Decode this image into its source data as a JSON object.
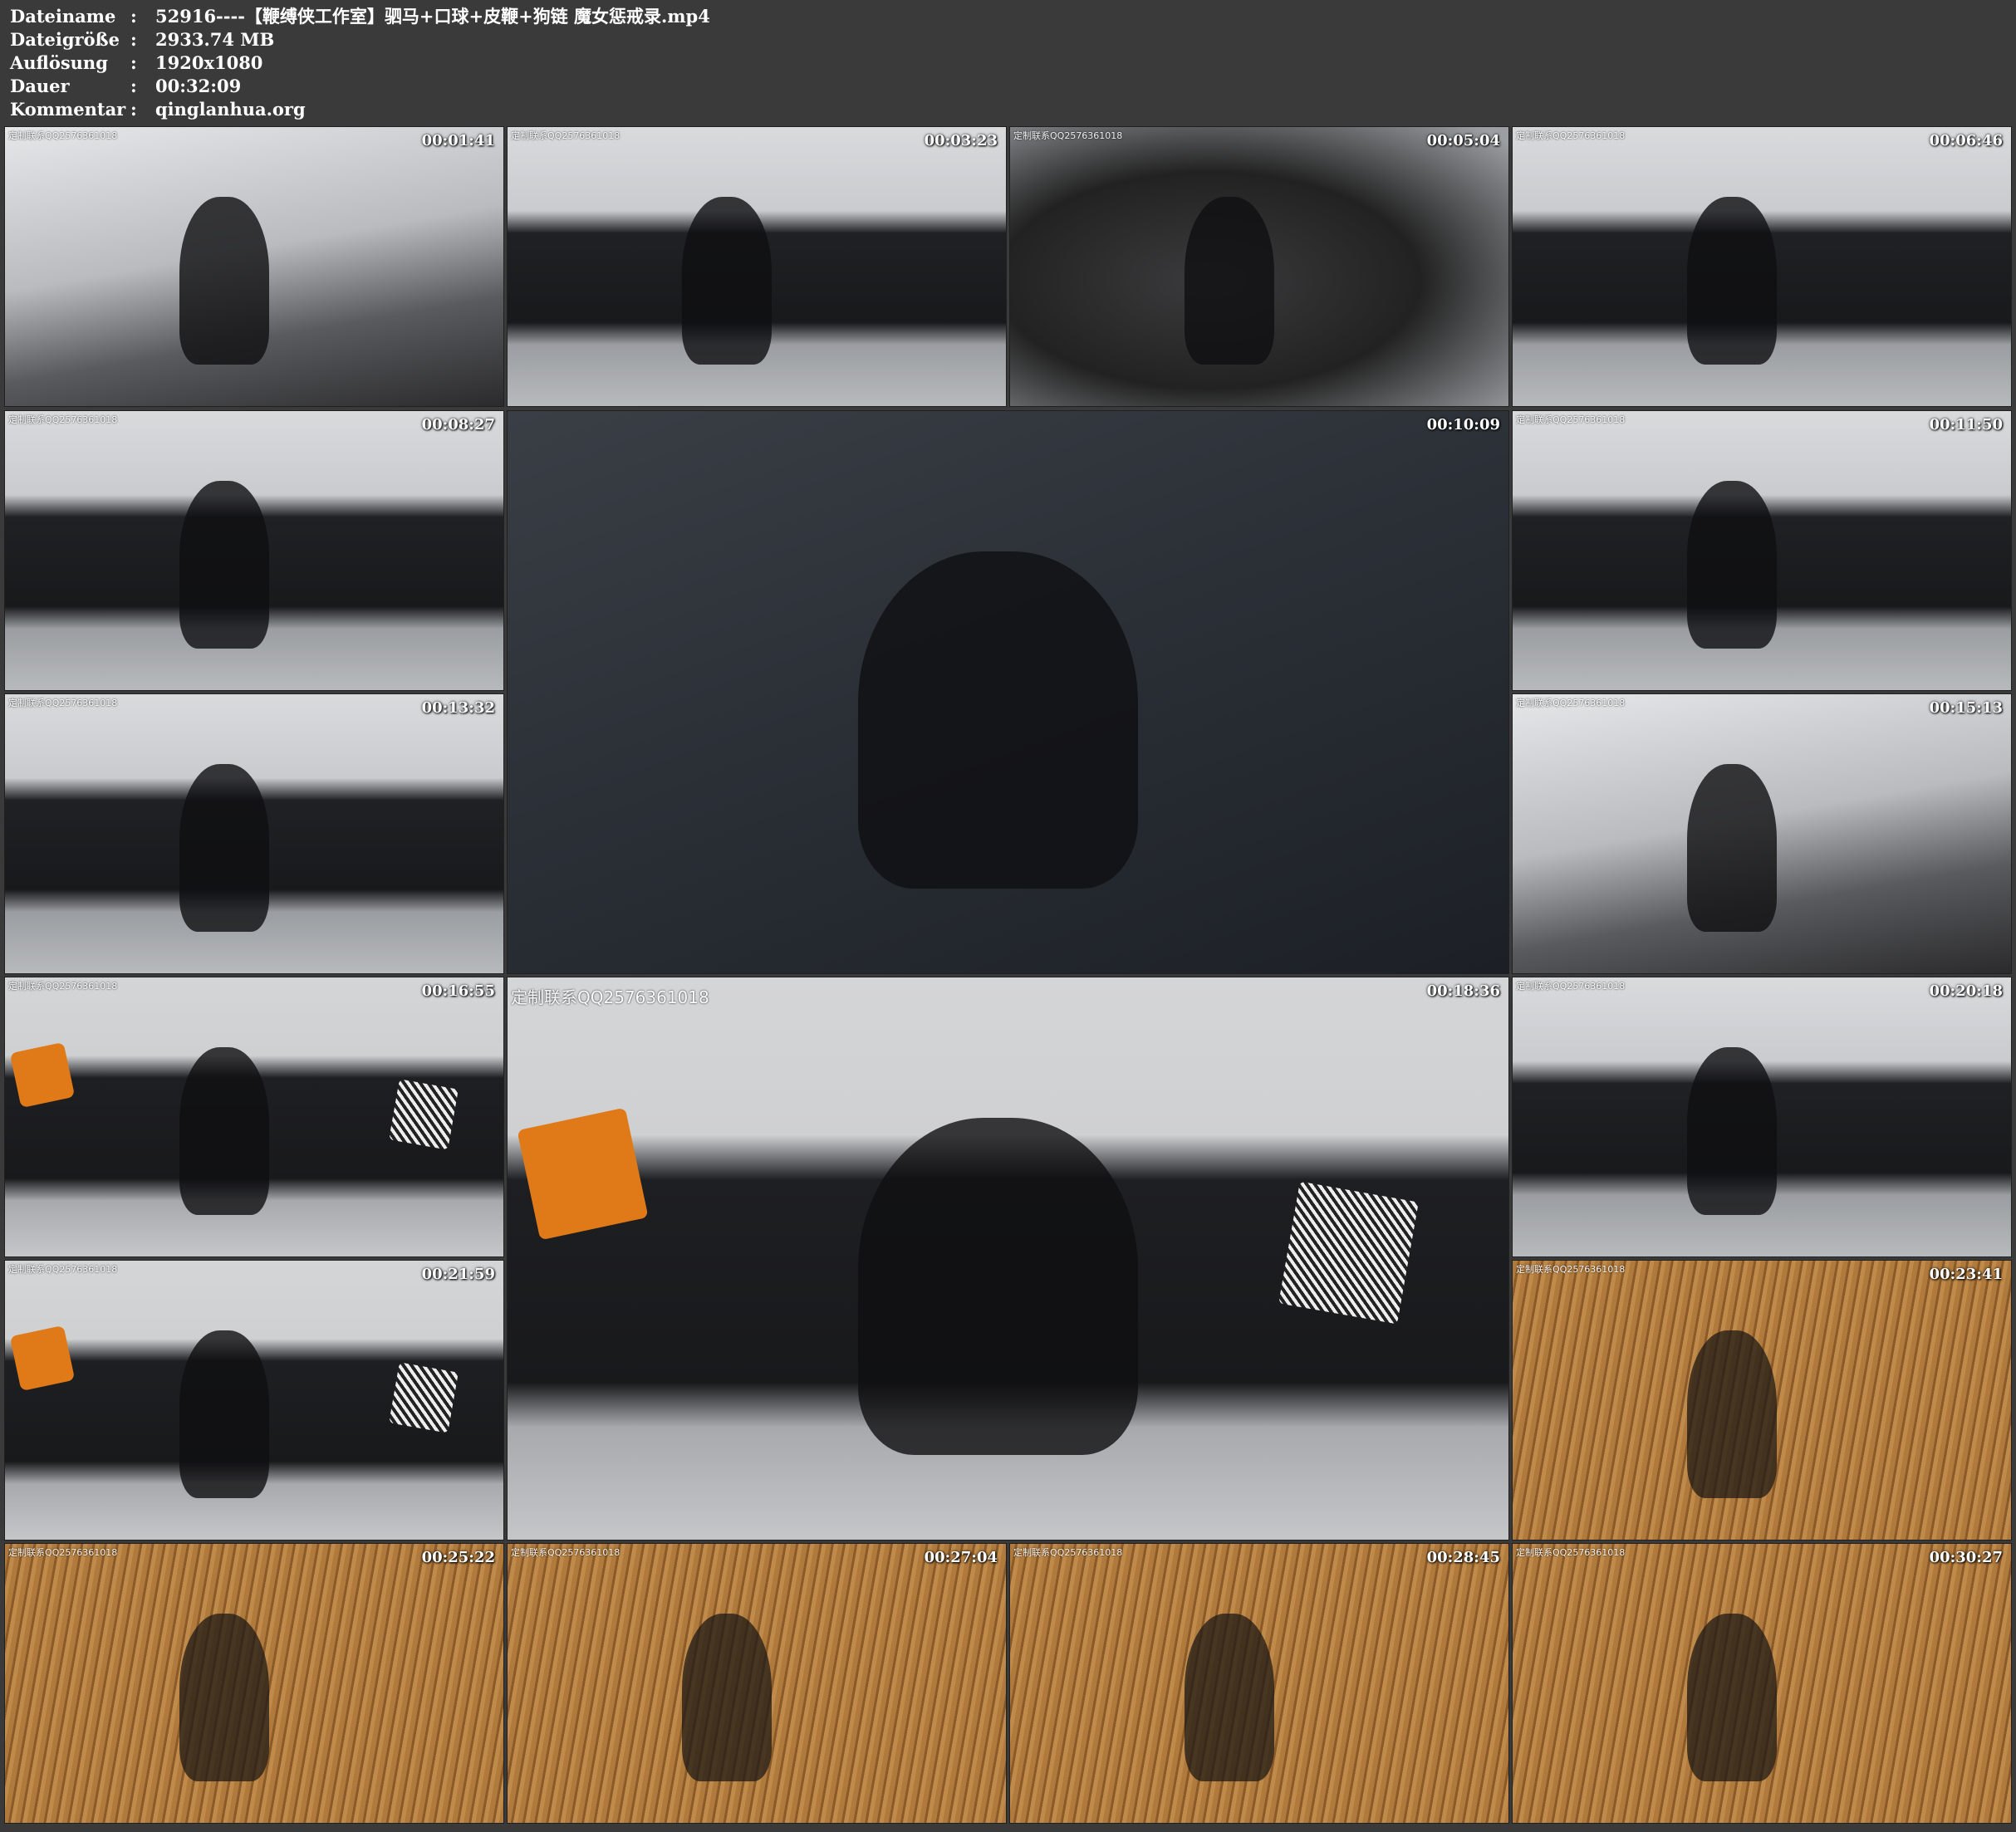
{
  "info": {
    "rows": [
      {
        "key": "Dateiname",
        "value": "52916----【鞭缚侠工作室】驷马+口球+皮鞭+狗链 魔女惩戒录.mp4"
      },
      {
        "key": "Dateigröße",
        "value": "2933.74 MB"
      },
      {
        "key": "Auflösung",
        "value": "1920x1080"
      },
      {
        "key": "Dauer",
        "value": "00:32:09"
      },
      {
        "key": "Kommentar",
        "value": "qinglanhua.org"
      }
    ],
    "colon": ":"
  },
  "watermark_text": "定制联系QQ2576361018",
  "thumbnails": [
    {
      "time": "00:01:41",
      "scene": "bg-room",
      "watermark": "定制联系QQ2576361018"
    },
    {
      "time": "00:03:23",
      "scene": "bg-sofa",
      "watermark": "定制联系QQ2576361018"
    },
    {
      "time": "00:05:04",
      "scene": "bg-close",
      "watermark": "定制联系QQ2576361018"
    },
    {
      "time": "00:06:46",
      "scene": "bg-sofa",
      "watermark": "定制联系QQ2576361018"
    },
    {
      "time": "00:08:27",
      "scene": "bg-sofa",
      "watermark": "定制联系QQ2576361018"
    },
    {
      "time": "00:10:09",
      "scene": "bg-lie",
      "watermark": ""
    },
    {
      "time": "00:11:50",
      "scene": "bg-sofa",
      "watermark": "定制联系QQ2576361018"
    },
    {
      "time": "00:13:32",
      "scene": "bg-sofa",
      "watermark": "定制联系QQ2576361018"
    },
    {
      "time": "00:15:13",
      "scene": "bg-room",
      "watermark": "定制联系QQ2576361018"
    },
    {
      "time": "00:16:55",
      "scene": "bg-orange",
      "watermark": "定制联系QQ2576361018"
    },
    {
      "time": "00:18:36",
      "scene": "bg-orange",
      "watermark": "定制联系QQ2576361018"
    },
    {
      "time": "00:20:18",
      "scene": "bg-sofa",
      "watermark": "定制联系QQ2576361018"
    },
    {
      "time": "00:21:59",
      "scene": "bg-orange",
      "watermark": "定制联系QQ2576361018"
    },
    {
      "time": "00:23:41",
      "scene": "bg-mat",
      "watermark": "定制联系QQ2576361018"
    },
    {
      "time": "00:25:22",
      "scene": "bg-mat",
      "watermark": "定制联系QQ2576361018"
    },
    {
      "time": "00:27:04",
      "scene": "bg-mat",
      "watermark": "定制联系QQ2576361018"
    },
    {
      "time": "00:28:45",
      "scene": "bg-mat",
      "watermark": "定制联系QQ2576361018"
    },
    {
      "time": "00:30:27",
      "scene": "bg-mat",
      "watermark": "定制联系QQ2576361018"
    }
  ]
}
